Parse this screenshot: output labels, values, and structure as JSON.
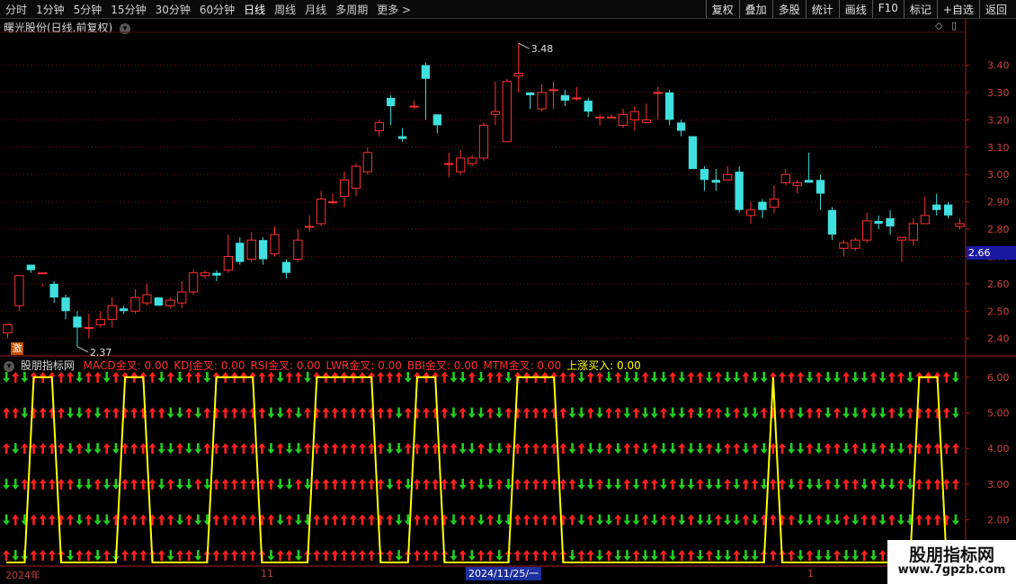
{
  "toolbar": {
    "periods": [
      "分时",
      "1分钟",
      "5分钟",
      "15分钟",
      "30分钟",
      "60分钟",
      "日线",
      "周线",
      "月线",
      "多周期",
      "更多 >"
    ],
    "active": "日线",
    "actions": [
      "复权",
      "叠加",
      "多股",
      "统计",
      "画线",
      "F10",
      "标记",
      "+自选",
      "返回"
    ]
  },
  "stock_title": "曙光股份(日线,前复权)",
  "price_tag": "2.66",
  "badge": "激",
  "high_label": "3.48",
  "low_label": "2.37",
  "indicator": {
    "name": "股朋指标网",
    "legend": [
      {
        "text": "MACD金叉: 0.00",
        "color": "#ff3030"
      },
      {
        "text": "KDJ金叉: 0.00",
        "color": "#ff3030"
      },
      {
        "text": "RSI金叉: 0.00",
        "color": "#ff3030"
      },
      {
        "text": "LWR金叉: 0.00",
        "color": "#ff3030"
      },
      {
        "text": "BBI金叉: 0.00",
        "color": "#ff3030"
      },
      {
        "text": "MTM金叉: 0.00",
        "color": "#ff3030"
      },
      {
        "text": "上涨买入: 0.00",
        "color": "#ffff00"
      }
    ]
  },
  "x_labels": [
    {
      "text": "2024年"
    },
    {
      "text": "11"
    },
    {
      "text": "1"
    }
  ],
  "date_selected": "2024/11/25/一",
  "watermark": {
    "line1": "股朋指标网",
    "line2": "www.7gpzb.com"
  },
  "colors": {
    "up": "#ff3030",
    "down": "#40e0e0",
    "arrow_up": "#ff2020",
    "arrow_down": "#20d020",
    "signal": "#ffff00"
  },
  "chart_data": [
    {
      "type": "candlestick",
      "ylim": [
        2.33,
        3.52
      ],
      "y_ticks": [
        2.4,
        2.5,
        2.6,
        2.7,
        2.8,
        2.9,
        3.0,
        3.1,
        3.2,
        3.3,
        3.4
      ],
      "candles": [
        [
          2.42,
          2.45,
          2.4,
          2.44
        ],
        [
          2.52,
          2.63,
          2.5,
          2.62
        ],
        [
          2.67,
          2.65,
          2.64,
          2.67
        ],
        [
          2.64,
          2.64,
          2.59,
          2.6
        ],
        [
          2.6,
          2.55,
          2.53,
          2.61
        ],
        [
          2.55,
          2.5,
          2.47,
          2.56
        ],
        [
          2.48,
          2.44,
          2.37,
          2.5
        ],
        [
          2.44,
          2.44,
          2.4,
          2.49
        ],
        [
          2.45,
          2.47,
          2.44,
          2.5
        ],
        [
          2.47,
          2.52,
          2.44,
          2.55
        ],
        [
          2.51,
          2.5,
          2.49,
          2.52
        ],
        [
          2.5,
          2.55,
          2.49,
          2.58
        ],
        [
          2.53,
          2.56,
          2.52,
          2.6
        ],
        [
          2.55,
          2.52,
          2.52,
          2.55
        ],
        [
          2.52,
          2.54,
          2.51,
          2.55
        ],
        [
          2.53,
          2.57,
          2.51,
          2.61
        ],
        [
          2.57,
          2.64,
          2.56,
          2.65
        ],
        [
          2.63,
          2.64,
          2.62,
          2.65
        ],
        [
          2.64,
          2.63,
          2.61,
          2.65
        ],
        [
          2.65,
          2.7,
          2.64,
          2.78
        ],
        [
          2.75,
          2.68,
          2.67,
          2.77
        ],
        [
          2.69,
          2.76,
          2.68,
          2.79
        ],
        [
          2.76,
          2.69,
          2.67,
          2.77
        ],
        [
          2.71,
          2.78,
          2.7,
          2.81
        ],
        [
          2.68,
          2.64,
          2.62,
          2.69
        ],
        [
          2.69,
          2.76,
          2.68,
          2.8
        ],
        [
          2.81,
          2.81,
          2.79,
          2.85
        ],
        [
          2.82,
          2.91,
          2.81,
          2.94
        ],
        [
          2.9,
          2.9,
          2.89,
          2.93
        ],
        [
          2.92,
          2.98,
          2.88,
          3.01
        ],
        [
          2.95,
          3.03,
          2.92,
          3.04
        ],
        [
          3.01,
          3.08,
          3.0,
          3.1
        ],
        [
          3.16,
          3.19,
          3.14,
          3.2
        ],
        [
          3.28,
          3.25,
          3.18,
          3.29
        ],
        [
          3.14,
          3.13,
          3.12,
          3.17
        ],
        [
          3.25,
          3.25,
          3.24,
          3.27
        ],
        [
          3.4,
          3.35,
          3.2,
          3.41
        ],
        [
          3.22,
          3.18,
          3.15,
          3.2
        ],
        [
          3.04,
          3.04,
          2.99,
          3.08
        ],
        [
          3.01,
          3.06,
          3.0,
          3.09
        ],
        [
          3.04,
          3.06,
          3.03,
          3.07
        ],
        [
          3.06,
          3.18,
          3.05,
          3.19
        ],
        [
          3.22,
          3.23,
          3.18,
          3.34
        ],
        [
          3.12,
          3.34,
          3.12,
          3.35
        ],
        [
          3.36,
          3.37,
          3.3,
          3.48
        ],
        [
          3.3,
          3.29,
          3.24,
          3.3
        ],
        [
          3.24,
          3.3,
          3.23,
          3.33
        ],
        [
          3.31,
          3.31,
          3.24,
          3.34
        ],
        [
          3.29,
          3.27,
          3.25,
          3.31
        ],
        [
          3.28,
          3.28,
          3.27,
          3.32
        ],
        [
          3.27,
          3.23,
          3.21,
          3.28
        ],
        [
          3.21,
          3.21,
          3.18,
          3.22
        ],
        [
          3.21,
          3.21,
          3.21,
          3.22
        ],
        [
          3.18,
          3.22,
          3.17,
          3.24
        ],
        [
          3.2,
          3.23,
          3.16,
          3.25
        ],
        [
          3.19,
          3.2,
          3.19,
          3.26
        ],
        [
          3.3,
          3.3,
          3.2,
          3.32
        ],
        [
          3.3,
          3.2,
          3.18,
          3.31
        ],
        [
          3.19,
          3.16,
          3.14,
          3.2
        ],
        [
          3.14,
          3.02,
          3.02,
          3.14
        ],
        [
          3.02,
          2.98,
          2.94,
          3.03
        ],
        [
          2.98,
          2.97,
          2.94,
          3.02
        ],
        [
          2.98,
          3.0,
          2.98,
          3.03
        ],
        [
          3.01,
          2.87,
          2.86,
          3.03
        ],
        [
          2.85,
          2.87,
          2.82,
          2.9
        ],
        [
          2.9,
          2.87,
          2.84,
          2.91
        ],
        [
          2.88,
          2.91,
          2.86,
          2.96
        ],
        [
          2.97,
          3.0,
          2.96,
          3.02
        ],
        [
          2.96,
          2.97,
          2.93,
          2.98
        ],
        [
          2.98,
          2.97,
          2.97,
          3.08
        ],
        [
          2.98,
          2.93,
          2.87,
          3.0
        ],
        [
          2.87,
          2.78,
          2.76,
          2.88
        ],
        [
          2.73,
          2.75,
          2.7,
          2.76
        ],
        [
          2.73,
          2.76,
          2.72,
          2.77
        ],
        [
          2.76,
          2.83,
          2.75,
          2.86
        ],
        [
          2.83,
          2.82,
          2.8,
          2.85
        ],
        [
          2.84,
          2.81,
          2.78,
          2.87
        ],
        [
          2.76,
          2.77,
          2.68,
          2.77
        ],
        [
          2.76,
          2.82,
          2.74,
          2.84
        ],
        [
          2.82,
          2.85,
          2.82,
          2.92
        ],
        [
          2.89,
          2.87,
          2.85,
          2.93
        ],
        [
          2.89,
          2.85,
          2.84,
          2.9
        ],
        [
          2.81,
          2.82,
          2.8,
          2.84
        ]
      ]
    },
    {
      "type": "signal-grid",
      "ylim": [
        0.75,
        6.25
      ],
      "y_ticks": [
        1.0,
        2.0,
        3.0,
        4.0,
        5.0,
        6.0
      ],
      "rows": 6,
      "signal_line": [
        0,
        0,
        0,
        6,
        6,
        6,
        0,
        0,
        0,
        0,
        0,
        0,
        0,
        6,
        6,
        6,
        0,
        0,
        0,
        0,
        0,
        0,
        0,
        6,
        6,
        6,
        6,
        6,
        0,
        0,
        0,
        0,
        0,
        0,
        6,
        6,
        6,
        6,
        6,
        6,
        6,
        0,
        0,
        0,
        0,
        6,
        6,
        6,
        0,
        0,
        0,
        0,
        0,
        0,
        0,
        0,
        6,
        6,
        6,
        6,
        6,
        0,
        0,
        0,
        0,
        0,
        0,
        0,
        0,
        0,
        0,
        0,
        0,
        0,
        0,
        0,
        0,
        0,
        0,
        0,
        0,
        0,
        0,
        0,
        6,
        0,
        0,
        0,
        0,
        0,
        0,
        0,
        0,
        0,
        0,
        0,
        0,
        0,
        0,
        0,
        6,
        6,
        6,
        0,
        0
      ]
    }
  ]
}
